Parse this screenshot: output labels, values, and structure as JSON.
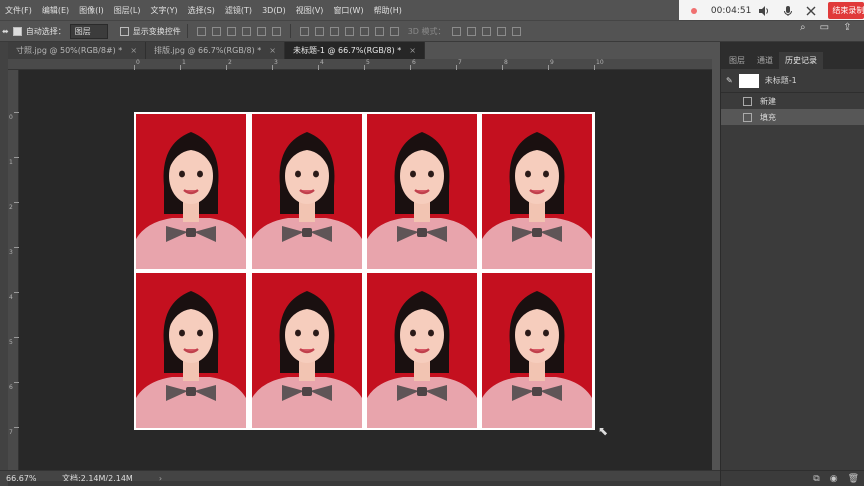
{
  "menu": [
    "文件(F)",
    "编辑(E)",
    "图像(I)",
    "图层(L)",
    "文字(Y)",
    "选择(S)",
    "滤镜(T)",
    "3D(D)",
    "视图(V)",
    "窗口(W)",
    "帮助(H)"
  ],
  "recorder": {
    "timer": "00:04:51",
    "end_label": "结束录制"
  },
  "options": {
    "auto_select_label": "自动选择：",
    "auto_select_value": "图层",
    "show_transform_label": "显示变换控件",
    "mode_3d_label": "3D 模式："
  },
  "tabs": [
    {
      "label": "寸照.jpg @ 50%(RGB/8#) *"
    },
    {
      "label": "排版.jpg @ 66.7%(RGB/8) *"
    },
    {
      "label": "未标题-1 @ 66.7%(RGB/8) *"
    }
  ],
  "rulers": {
    "horizontal": [
      "0",
      "1",
      "2",
      "3",
      "4",
      "5",
      "6",
      "7",
      "8",
      "9",
      "10"
    ],
    "vertical": [
      "0",
      "1",
      "2",
      "3",
      "4",
      "5",
      "6",
      "7"
    ]
  },
  "status": {
    "zoom": "66.67%",
    "doc": "文档:2.14M/2.14M"
  },
  "panel": {
    "tabs": [
      "图层",
      "通道",
      "历史记录"
    ],
    "snapshot_name": "未标题-1",
    "history": [
      {
        "label": "新建"
      },
      {
        "label": "填充"
      }
    ]
  },
  "colors": {
    "photo_background": "#c4101f",
    "canvas": "#282828",
    "ui": "#535353"
  }
}
